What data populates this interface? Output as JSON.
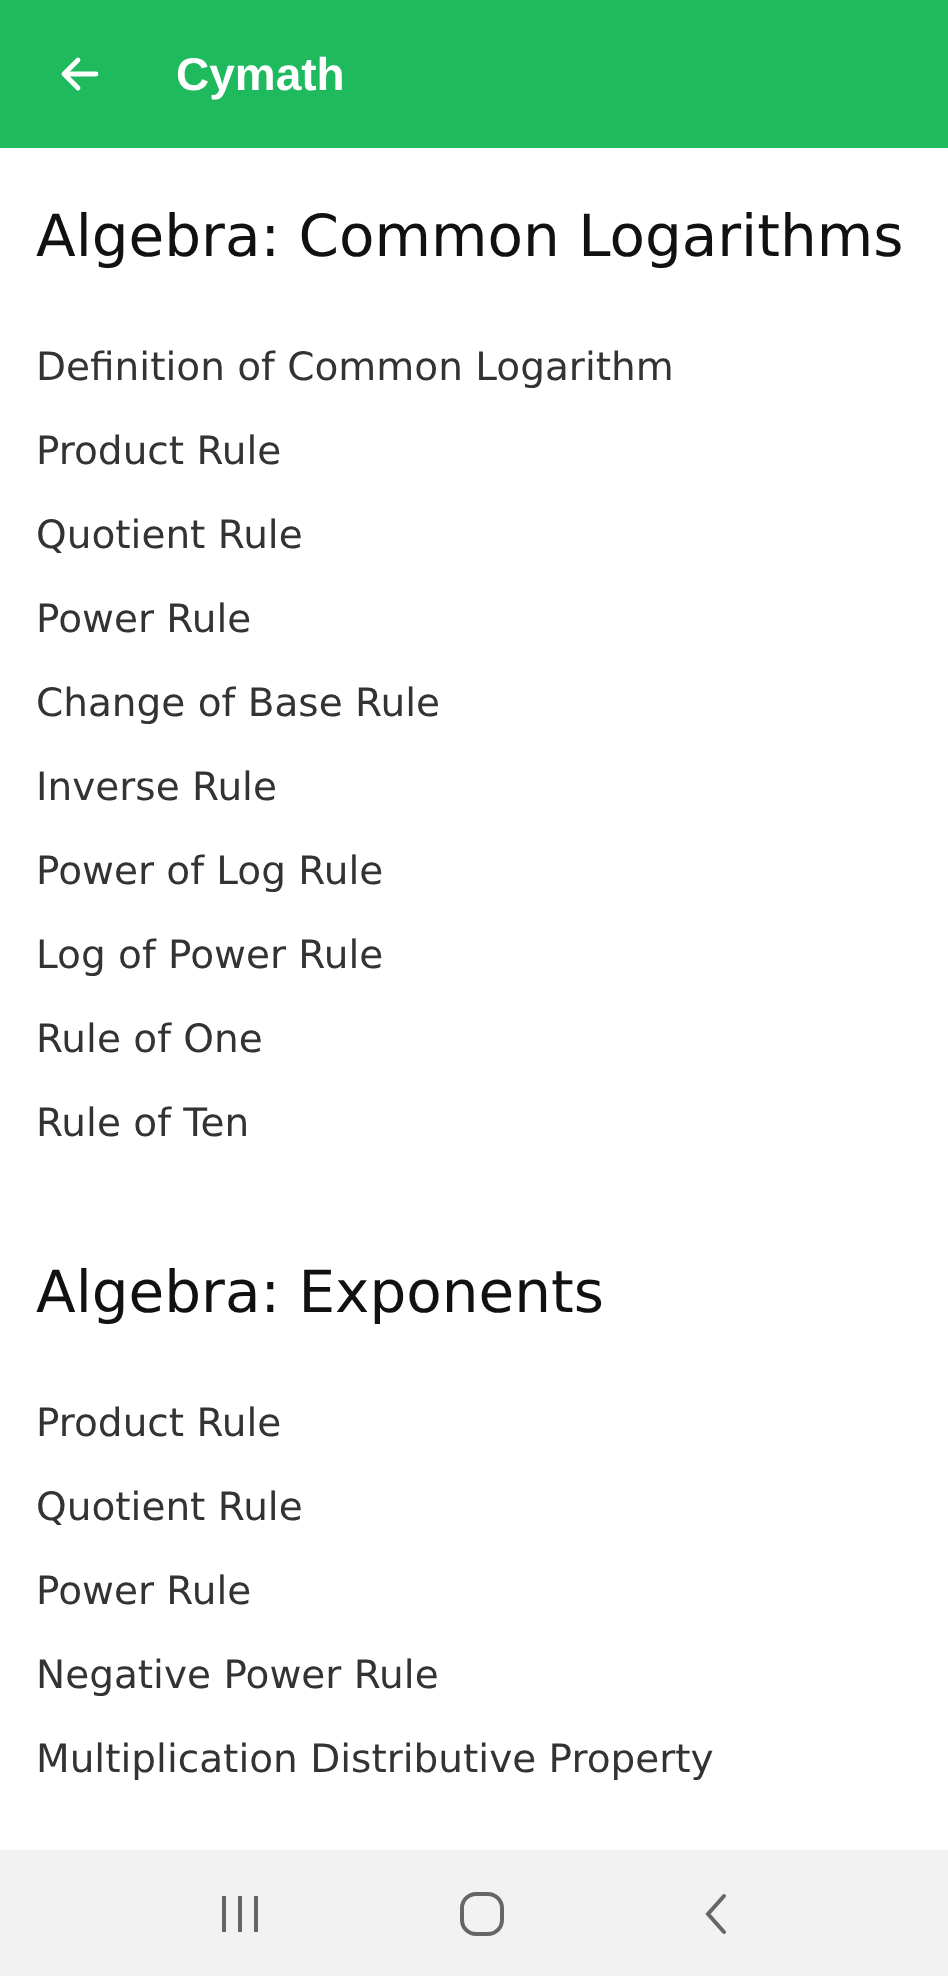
{
  "app_bar": {
    "title": "Cymath"
  },
  "sections": [
    {
      "heading": "Algebra: Common Logarithms",
      "items": [
        "Definition of Common Logarithm",
        "Product Rule",
        "Quotient Rule",
        "Power Rule",
        "Change of Base Rule",
        "Inverse Rule",
        "Power of Log Rule",
        "Log of Power Rule",
        "Rule of One",
        "Rule of Ten"
      ]
    },
    {
      "heading": "Algebra: Exponents",
      "items": [
        "Product Rule",
        "Quotient Rule",
        "Power Rule",
        "Negative Power Rule",
        "Multiplication Distributive Property"
      ]
    }
  ]
}
